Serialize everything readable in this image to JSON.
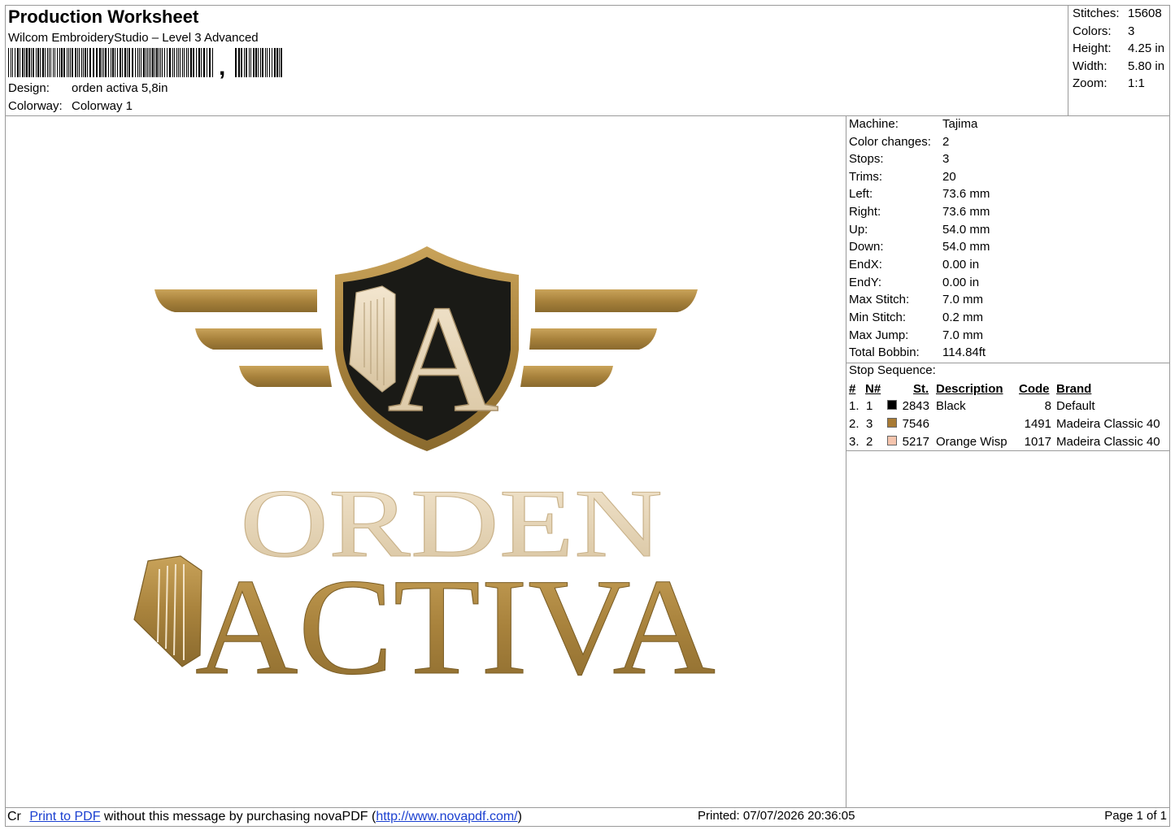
{
  "header": {
    "title": "Production Worksheet",
    "software": "Wilcom EmbroideryStudio – Level 3 Advanced",
    "barcode_comma": ",",
    "design_label": "Design:",
    "design_value": "orden activa 5,8in",
    "colorway_label": "Colorway:",
    "colorway_value": "Colorway 1"
  },
  "summary": [
    {
      "label": "Stitches:",
      "value": "15608"
    },
    {
      "label": "Colors:",
      "value": "3"
    },
    {
      "label": "Height:",
      "value": "4.25 in"
    },
    {
      "label": "Width:",
      "value": "5.80 in"
    },
    {
      "label": "Zoom:",
      "value": "1:1"
    }
  ],
  "machine_info": [
    {
      "label": "Machine:",
      "value": "Tajima"
    },
    {
      "label": "Color changes:",
      "value": "2"
    },
    {
      "label": "Stops:",
      "value": "3"
    },
    {
      "label": "Trims:",
      "value": "20"
    },
    {
      "label": "Left:",
      "value": "73.6 mm"
    },
    {
      "label": "Right:",
      "value": "73.6 mm"
    },
    {
      "label": "Up:",
      "value": "54.0 mm"
    },
    {
      "label": "Down:",
      "value": "54.0 mm"
    },
    {
      "label": "EndX:",
      "value": "0.00 in"
    },
    {
      "label": "EndY:",
      "value": "0.00 in"
    },
    {
      "label": "Max Stitch:",
      "value": "7.0 mm"
    },
    {
      "label": "Min Stitch:",
      "value": "0.2 mm"
    },
    {
      "label": "Max Jump:",
      "value": "7.0 mm"
    },
    {
      "label": "Total Bobbin:",
      "value": "114.84ft"
    }
  ],
  "stop_sequence": {
    "title": "Stop Sequence:",
    "columns": [
      "#",
      "N#",
      "St.",
      "Description",
      "Code",
      "Brand"
    ],
    "rows": [
      {
        "idx": "1.",
        "n": "1",
        "color": "#000000",
        "st": "2843",
        "desc": "Black",
        "code": "8",
        "brand": "Default"
      },
      {
        "idx": "2.",
        "n": "3",
        "color": "#a87a34",
        "st": "7546",
        "desc": "",
        "code": "1491",
        "brand": "Madeira Classic 40"
      },
      {
        "idx": "3.",
        "n": "2",
        "color": "#f5c4ad",
        "st": "5217",
        "desc": "Orange Wisp",
        "code": "1017",
        "brand": "Madeira Classic 40"
      }
    ]
  },
  "design_artwork": {
    "line1": "ORDEN",
    "line2": "ACTIVA",
    "crest_letter": "A",
    "colors": {
      "gold": "#a8823c",
      "black": "#1a1a16",
      "cream": "#e9d9bd"
    }
  },
  "footer": {
    "prefix": "Cr",
    "link1": "Print to PDF",
    "middle": " without this message by purchasing novaPDF (",
    "link2": "http://www.novapdf.com/",
    "end": ")",
    "printed": "Printed: 07/07/2026 20:36:05",
    "page": "Page 1 of 1"
  }
}
